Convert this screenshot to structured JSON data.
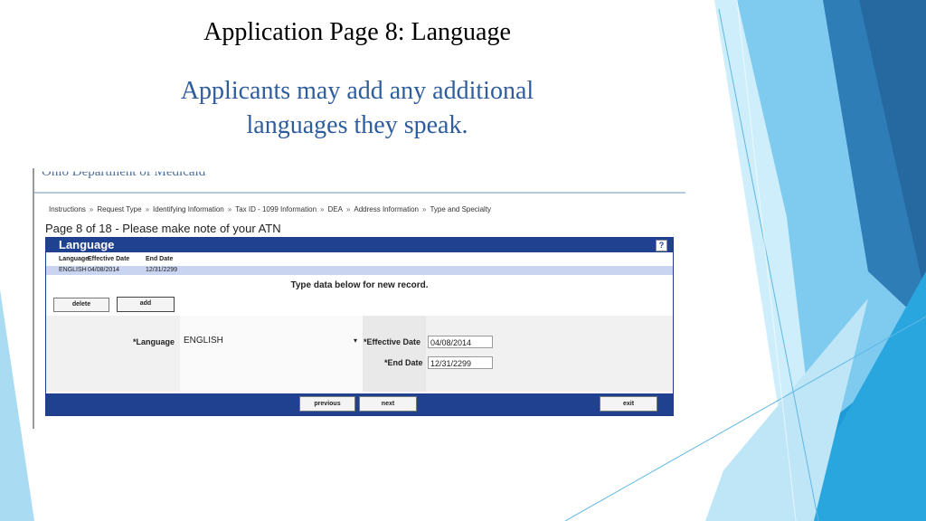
{
  "slide": {
    "title": "Application Page 8:  Language",
    "subtitle_line1": "Applicants may add any additional",
    "subtitle_line2": "languages they speak."
  },
  "screenshot": {
    "dept_name": "Ohio Department of Medicaid",
    "breadcrumbs": [
      "Instructions",
      "Request Type",
      "Identifying Information",
      "Tax ID - 1099 Information",
      "DEA",
      "Address Information",
      "Type and Specialty"
    ],
    "breadcrumb_separator": "»",
    "page_info": "Page 8 of 18 - Please make note of your ATN",
    "panel": {
      "title": "Language",
      "help_label": "?",
      "columns": [
        "Language",
        "Effective Date",
        "End Date"
      ],
      "rows": [
        {
          "language": "ENGLISH",
          "effective_date": "04/08/2014",
          "end_date": "12/31/2299"
        }
      ],
      "instruction": "Type data below for new record.",
      "delete_label": "delete",
      "add_label": "add",
      "form": {
        "language_label": "*Language",
        "language_value": "ENGLISH",
        "dropdown_arrow": "▾",
        "effective_date_label": "*Effective Date",
        "effective_date_value": "04/08/2014",
        "end_date_label": "*End Date",
        "end_date_value": "12/31/2299"
      },
      "footer": {
        "previous_label": "previous",
        "next_label": "next",
        "exit_label": "exit"
      }
    }
  },
  "colors": {
    "title_text": "#000000",
    "subtitle_text": "#2e5d9e",
    "panel_header": "#1f4190",
    "selected_row": "#c8d4f0",
    "decor_light": "#a9dcf3",
    "decor_mid": "#4fb3e3",
    "decor_dark": "#2a6fa8"
  }
}
